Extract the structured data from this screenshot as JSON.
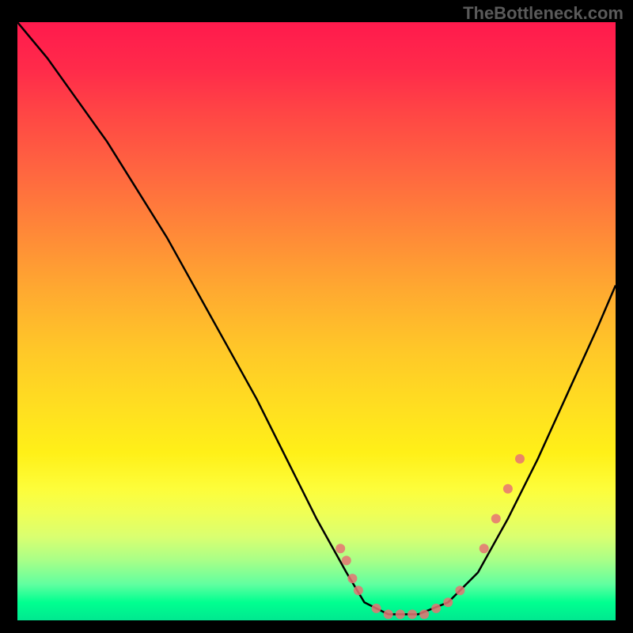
{
  "watermark": "TheBottleneck.com",
  "chart_data": {
    "type": "line",
    "title": "",
    "xlabel": "",
    "ylabel": "",
    "xlim": [
      0,
      100
    ],
    "ylim": [
      0,
      100
    ],
    "background_gradient": {
      "direction": "vertical",
      "representing": "bottleneck severity (red=high, green=low)",
      "stops": [
        {
          "pos": 0,
          "color": "#ff1a4d"
        },
        {
          "pos": 50,
          "color": "#ffc828"
        },
        {
          "pos": 80,
          "color": "#fdfd3a"
        },
        {
          "pos": 100,
          "color": "#00e890"
        }
      ]
    },
    "series": [
      {
        "name": "bottleneck-curve",
        "type": "line",
        "color": "#000000",
        "x": [
          0,
          5,
          10,
          15,
          20,
          25,
          30,
          35,
          40,
          45,
          50,
          55,
          58,
          62,
          67,
          72,
          77,
          82,
          87,
          92,
          97,
          100
        ],
        "y": [
          100,
          94,
          87,
          80,
          72,
          64,
          55,
          46,
          37,
          27,
          17,
          8,
          3,
          1,
          1,
          3,
          8,
          17,
          27,
          38,
          49,
          56
        ]
      },
      {
        "name": "data-points",
        "type": "scatter",
        "color": "#e67373",
        "x": [
          54,
          55,
          56,
          57,
          60,
          62,
          64,
          66,
          68,
          70,
          72,
          74,
          78,
          80,
          82,
          84
        ],
        "y": [
          12,
          10,
          7,
          5,
          2,
          1,
          1,
          1,
          1,
          2,
          3,
          5,
          12,
          17,
          22,
          27
        ]
      }
    ]
  }
}
